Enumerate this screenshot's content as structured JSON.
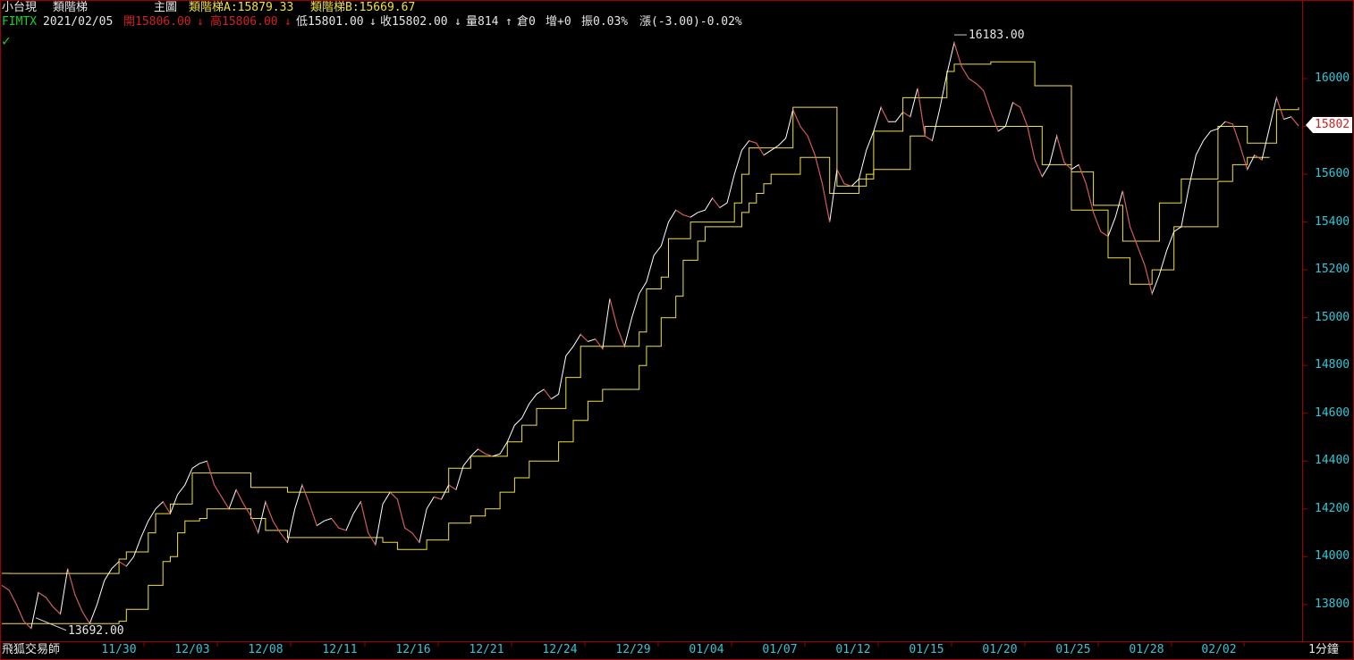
{
  "header": {
    "instrument": "小台現",
    "indicator": "類階梯",
    "panel": "主圖",
    "ind_a": "類階梯A:15879.33",
    "ind_b": "類階梯B:15669.67",
    "symbol": "FIMTX",
    "date": "2021/02/05",
    "open": "開15806.00",
    "high": "高15806.00",
    "low": "低15801.00",
    "close": "收15802.00",
    "volume": "量814",
    "oi": "倉0",
    "oi_change": "增+0",
    "amplitude": "振0.03%",
    "change": "漲(-3.00)-0.02%"
  },
  "footer": {
    "brand": "飛狐交易師",
    "period": "1分鐘"
  },
  "last_price_label": "15802",
  "high_marker": "16183.00",
  "low_marker": "13692.00",
  "colors": {
    "background": "#000000",
    "frame": "#a00000",
    "price": "#ffffff",
    "price_down": "#d02020",
    "ladder": "#f0e040",
    "axis_text": "#33c6d6"
  },
  "chart_data": {
    "type": "line",
    "y_axis_side": "right",
    "ylim": [
      13700,
      16250
    ],
    "yticks": [
      13800,
      14000,
      14200,
      14400,
      14600,
      14800,
      15000,
      15200,
      15400,
      15600,
      15800,
      16000
    ],
    "x_labels": [
      "11/30",
      "12/03",
      "12/08",
      "12/11",
      "12/16",
      "12/21",
      "12/24",
      "12/29",
      "01/04",
      "01/07",
      "01/12",
      "01/15",
      "01/20",
      "01/25",
      "01/28",
      "02/02"
    ],
    "series": [
      {
        "values": [
          13880,
          13860,
          13800,
          13730,
          13700,
          13850,
          13830,
          13790,
          13760,
          13950,
          13840,
          13770,
          13720,
          13800,
          13900,
          13950,
          13980,
          13960,
          14000,
          14080,
          14150,
          14200,
          14230,
          14180,
          14260,
          14300,
          14370,
          14390,
          14400,
          14300,
          14250,
          14200,
          14280,
          14220,
          14170,
          14100,
          14230,
          14150,
          14100,
          14060,
          14200,
          14300,
          14220,
          14130,
          14150,
          14160,
          14120,
          14110,
          14180,
          14230,
          14100,
          14050,
          14220,
          14270,
          14240,
          14120,
          14100,
          14060,
          14200,
          14250,
          14240,
          14300,
          14280,
          14380,
          14420,
          14450,
          14430,
          14420,
          14430,
          14480,
          14550,
          14580,
          14640,
          14680,
          14700,
          14660,
          14680,
          14840,
          14880,
          14930,
          14900,
          14910,
          14870,
          15080,
          14960,
          14880,
          15000,
          15100,
          15150,
          15260,
          15300,
          15400,
          15450,
          15430,
          15420,
          15440,
          15450,
          15500,
          15460,
          15480,
          15600,
          15700,
          15740,
          15730,
          15680,
          15700,
          15720,
          15750,
          15870,
          15800,
          15760,
          15680,
          15560,
          15400,
          15620,
          15560,
          15550,
          15580,
          15700,
          15780,
          15880,
          15820,
          15820,
          15860,
          15840,
          15960,
          15760,
          15740,
          15870,
          16020,
          16150,
          16050,
          16000,
          15980,
          15950,
          15860,
          15780,
          15800,
          15900,
          15880,
          15800,
          15660,
          15590,
          15640,
          15760,
          15650,
          15620,
          15640,
          15560,
          15440,
          15360,
          15340,
          15420,
          15530,
          15380,
          15300,
          15220,
          15100,
          15180,
          15280,
          15360,
          15380,
          15540,
          15680,
          15740,
          15780,
          15790,
          15820,
          15810,
          15720,
          15620,
          15680,
          15660,
          15790,
          15920,
          15830,
          15840,
          15802
        ]
      },
      {
        "values": [
          13930,
          13930,
          13930,
          13930,
          13930,
          13930,
          13930,
          13930,
          13930,
          13930,
          13930,
          13930,
          13930,
          13930,
          13930,
          13930,
          13990,
          14020,
          14020,
          14020,
          14100,
          14180,
          14180,
          14220,
          14220,
          14220,
          14350,
          14350,
          14350,
          14350,
          14350,
          14350,
          14350,
          14350,
          14290,
          14290,
          14290,
          14290,
          14290,
          14270,
          14270,
          14270,
          14270,
          14270,
          14270,
          14270,
          14270,
          14270,
          14270,
          14270,
          14270,
          14270,
          14270,
          14270,
          14270,
          14270,
          14270,
          14270,
          14270,
          14270,
          14270,
          14370,
          14370,
          14370,
          14420,
          14420,
          14420,
          14420,
          14420,
          14480,
          14480,
          14550,
          14550,
          14620,
          14620,
          14620,
          14620,
          14750,
          14750,
          14880,
          14880,
          14880,
          14880,
          14880,
          14880,
          14880,
          14880,
          14940,
          15120,
          15120,
          15170,
          15330,
          15330,
          15330,
          15400,
          15400,
          15400,
          15400,
          15400,
          15400,
          15480,
          15600,
          15710,
          15710,
          15710,
          15710,
          15710,
          15710,
          15880,
          15880,
          15880,
          15880,
          15880,
          15880,
          15550,
          15550,
          15550,
          15550,
          15600,
          15780,
          15780,
          15780,
          15780,
          15920,
          15920,
          15920,
          15920,
          15920,
          15920,
          16030,
          16060,
          16060,
          16060,
          16060,
          16060,
          16070,
          16070,
          16070,
          16070,
          16070,
          16070,
          15970,
          15970,
          15970,
          15970,
          15970,
          15610,
          15610,
          15610,
          15470,
          15470,
          15470,
          15470,
          15320,
          15320,
          15320,
          15320,
          15320,
          15480,
          15480,
          15480,
          15580,
          15580,
          15580,
          15580,
          15580,
          15800,
          15800,
          15800,
          15800,
          15730,
          15730,
          15730,
          15730,
          15870,
          15870,
          15870,
          15879.33
        ]
      },
      {
        "values": [
          13720,
          13720,
          13720,
          13720,
          13720,
          13720,
          13720,
          13720,
          13720,
          13720,
          13720,
          13720,
          13720,
          13720,
          13720,
          13720,
          13730,
          13780,
          13780,
          13780,
          13880,
          13880,
          13980,
          14000,
          14100,
          14150,
          14150,
          14160,
          14200,
          14200,
          14200,
          14200,
          14200,
          14200,
          14160,
          14160,
          14110,
          14110,
          14110,
          14080,
          14080,
          14080,
          14080,
          14080,
          14080,
          14080,
          14080,
          14080,
          14080,
          14080,
          14080,
          14080,
          14060,
          14060,
          14030,
          14030,
          14030,
          14030,
          14070,
          14070,
          14070,
          14140,
          14140,
          14140,
          14170,
          14170,
          14200,
          14200,
          14270,
          14270,
          14330,
          14330,
          14400,
          14400,
          14400,
          14400,
          14480,
          14480,
          14570,
          14570,
          14650,
          14650,
          14700,
          14700,
          14700,
          14700,
          14700,
          14800,
          14880,
          14880,
          15000,
          15000,
          15090,
          15240,
          15240,
          15320,
          15380,
          15380,
          15380,
          15380,
          15380,
          15440,
          15480,
          15520,
          15560,
          15600,
          15600,
          15600,
          15600,
          15670,
          15670,
          15670,
          15670,
          15520,
          15520,
          15520,
          15520,
          15580,
          15580,
          15620,
          15620,
          15620,
          15620,
          15620,
          15760,
          15760,
          15800,
          15800,
          15800,
          15800,
          15800,
          15800,
          15800,
          15800,
          15800,
          15800,
          15800,
          15800,
          15800,
          15800,
          15800,
          15800,
          15640,
          15640,
          15640,
          15640,
          15450,
          15450,
          15450,
          15450,
          15450,
          15250,
          15250,
          15250,
          15140,
          15140,
          15140,
          15200,
          15200,
          15200,
          15380,
          15380,
          15380,
          15380,
          15380,
          15380,
          15570,
          15570,
          15640,
          15640,
          15670,
          15670,
          15670,
          15669.67
        ]
      }
    ]
  }
}
